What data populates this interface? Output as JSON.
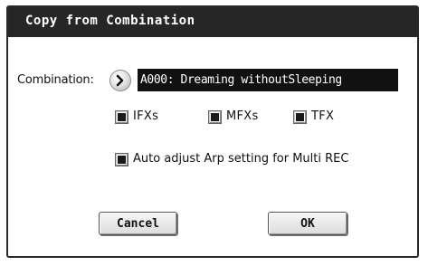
{
  "dialog": {
    "title": "Copy from Combination",
    "combination": {
      "label": "Combination:",
      "value": "A000: Dreaming withoutSleeping",
      "select_icon": "right-arrow-circle-icon"
    },
    "checkboxes": [
      {
        "label": "IFXs",
        "checked": true
      },
      {
        "label": "MFXs",
        "checked": true
      },
      {
        "label": "TFX",
        "checked": true
      }
    ],
    "auto_adjust": {
      "label": "Auto adjust Arp setting for Multi REC",
      "checked": true
    },
    "buttons": {
      "cancel": "Cancel",
      "ok": "OK"
    }
  }
}
